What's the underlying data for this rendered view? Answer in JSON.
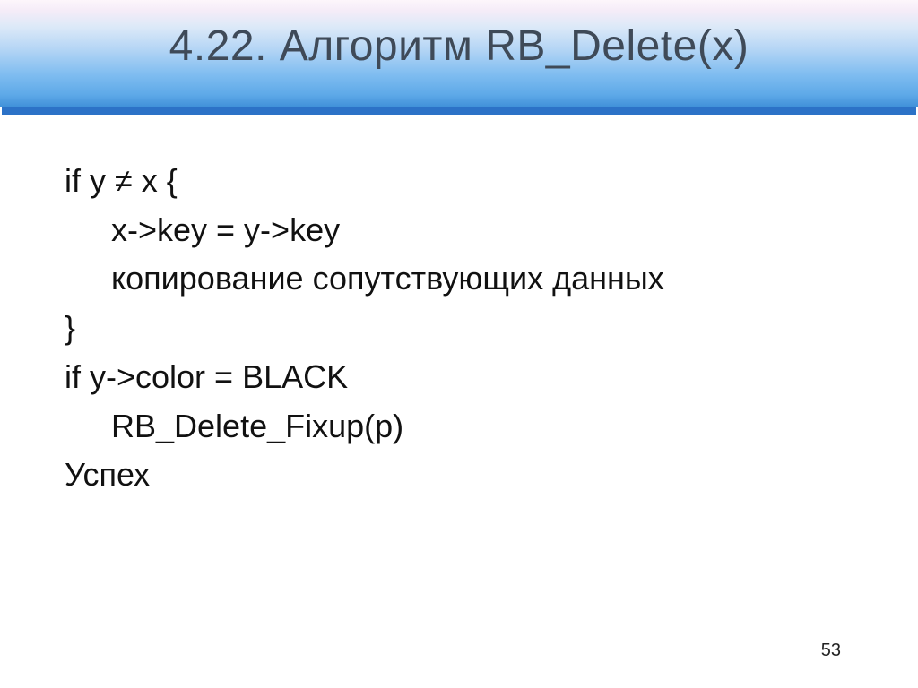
{
  "slide": {
    "title": "4.22. Алгоритм RB_Delete(x)",
    "lines": {
      "l1": "if y ≠ x {",
      "l2": "x->key = y->key",
      "l3": "копирование сопутствующих данных",
      "l4": "}",
      "l5": "if y->color = BLACK",
      "l6": "RB_Delete_Fixup(p)",
      "l7": "Успех"
    },
    "page_number": "53"
  }
}
